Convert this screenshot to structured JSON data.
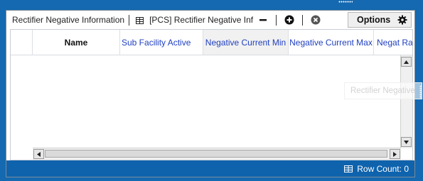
{
  "toolbar": {
    "title": "Rectifier Negative Information",
    "view_name": "[PCS] Rectifier Negative Inf",
    "collapse_icon": "minus-icon",
    "add_icon": "plus-circle-icon",
    "remove_icon": "close-circle-icon",
    "options_label": "Options",
    "options_icon": "gear-icon"
  },
  "grid": {
    "columns": [
      {
        "label": "Name"
      },
      {
        "label": "Sub Facility Active"
      },
      {
        "label": "Negative Current Min"
      },
      {
        "label": "Negative Current Max"
      },
      {
        "label": "Negat Ra"
      }
    ],
    "rows": []
  },
  "drag_ghost": {
    "text": "Rectifier Negative"
  },
  "status": {
    "row_count_label": "Row Count:",
    "row_count": "0",
    "icon": "table-icon"
  },
  "colors": {
    "accent": "#1469b0",
    "status_bar": "#0f63ad",
    "header_link": "#1f3fc0"
  }
}
